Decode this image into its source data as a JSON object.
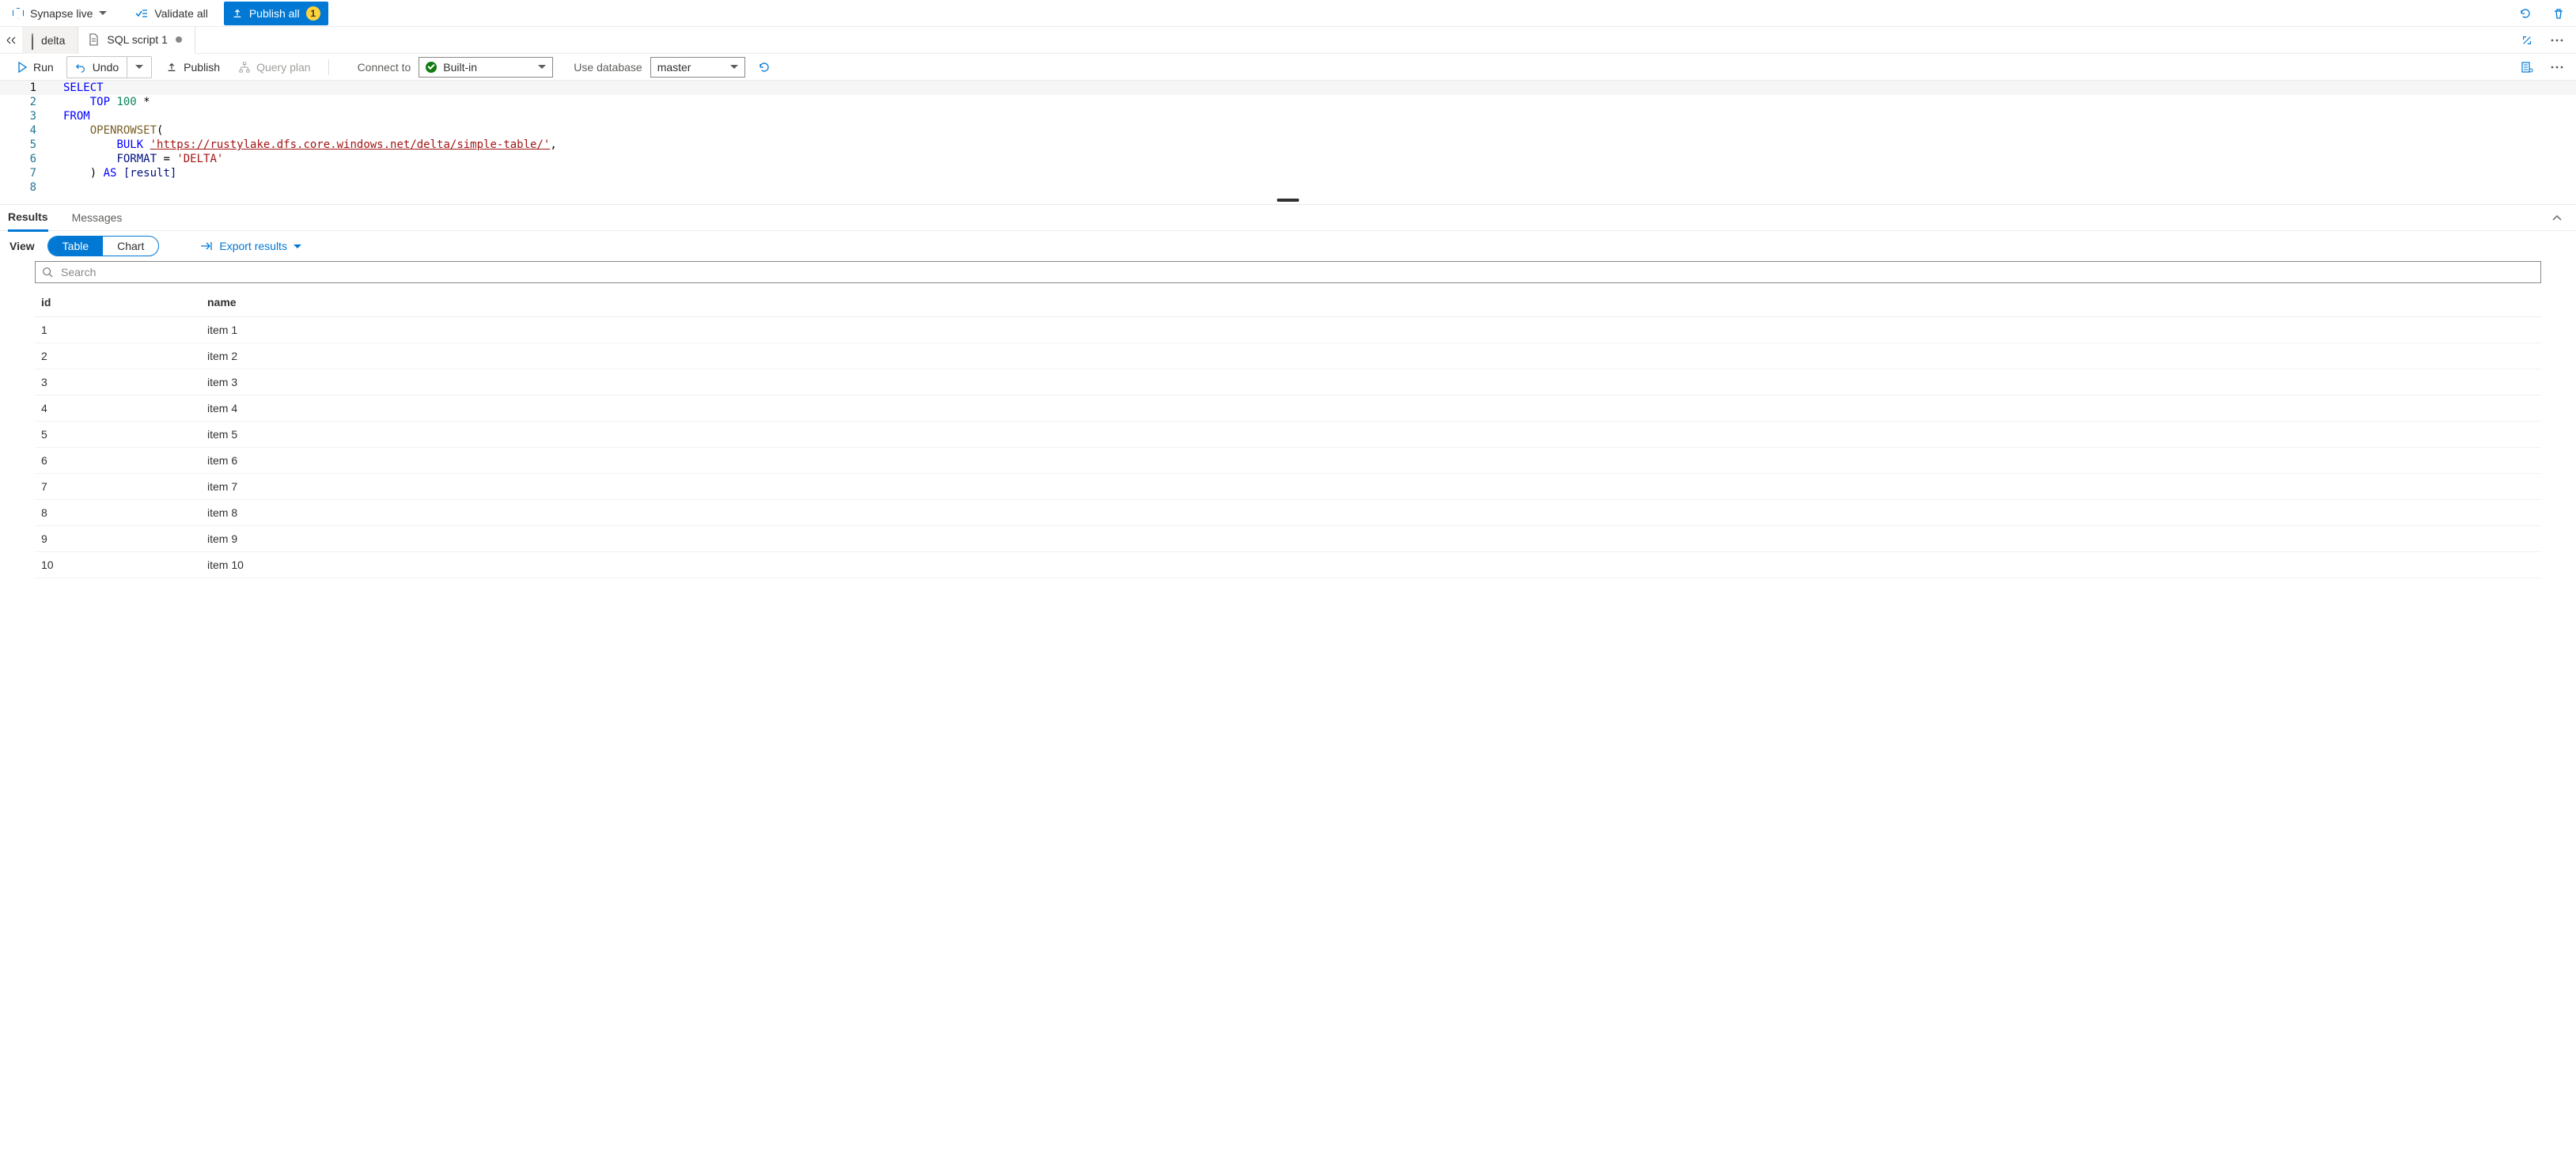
{
  "topbar": {
    "synapse_label": "Synapse live",
    "validate_label": "Validate all",
    "publish_label": "Publish all",
    "publish_count": "1"
  },
  "tabs": {
    "items": [
      {
        "label": "delta",
        "active": false,
        "dirty": false
      },
      {
        "label": "SQL script 1",
        "active": true,
        "dirty": true
      }
    ]
  },
  "toolbar": {
    "run": "Run",
    "undo": "Undo",
    "publish": "Publish",
    "query_plan": "Query plan",
    "connect_to_label": "Connect to",
    "connect_value": "Built-in",
    "use_db_label": "Use database",
    "use_db_value": "master"
  },
  "editor": {
    "lines": [
      "1",
      "2",
      "3",
      "4",
      "5",
      "6",
      "7",
      "8"
    ],
    "code": {
      "l1_select": "SELECT",
      "l2_indent": "    ",
      "l2_top": "TOP",
      "l2_num": " 100 ",
      "l2_star": "*",
      "l3_from": "FROM",
      "l4_indent": "    ",
      "l4_openrowset": "OPENROWSET",
      "l4_paren": "(",
      "l5_indent": "        ",
      "l5_bulk": "BULK",
      "l5_sp": " ",
      "l5_url": "'https://rustylake.dfs.core.windows.net/delta/simple-table/'",
      "l5_comma": ",",
      "l6_indent": "        ",
      "l6_key": "FORMAT",
      "l6_eq": " = ",
      "l6_val": "'DELTA'",
      "l7_indent": "    ",
      "l7_close": ") ",
      "l7_as": "AS",
      "l7_alias": " [result]"
    }
  },
  "results": {
    "tabs": {
      "results": "Results",
      "messages": "Messages"
    },
    "view_label": "View",
    "toggle": {
      "table": "Table",
      "chart": "Chart"
    },
    "export_label": "Export results",
    "search_placeholder": "Search",
    "columns": [
      "id",
      "name"
    ],
    "rows": [
      {
        "id": "1",
        "name": "item 1"
      },
      {
        "id": "2",
        "name": "item 2"
      },
      {
        "id": "3",
        "name": "item 3"
      },
      {
        "id": "4",
        "name": "item 4"
      },
      {
        "id": "5",
        "name": "item 5"
      },
      {
        "id": "6",
        "name": "item 6"
      },
      {
        "id": "7",
        "name": "item 7"
      },
      {
        "id": "8",
        "name": "item 8"
      },
      {
        "id": "9",
        "name": "item 9"
      },
      {
        "id": "10",
        "name": "item 10"
      }
    ]
  }
}
